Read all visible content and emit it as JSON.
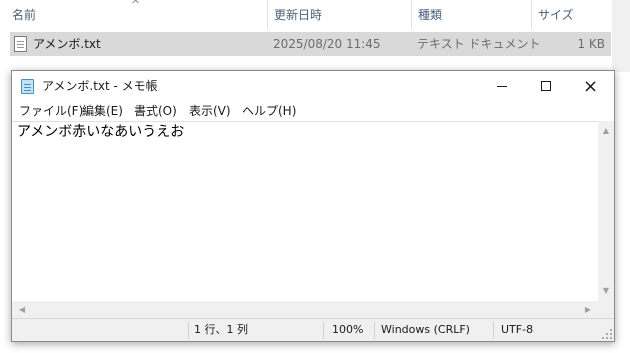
{
  "explorer": {
    "columns": {
      "name": "名前",
      "modified": "更新日時",
      "type": "種類",
      "size": "サイズ"
    },
    "sort_arrow": "^",
    "file": {
      "name": "アメンボ.txt",
      "modified": "2025/08/20 11:45",
      "type": "テキスト ドキュメント",
      "size": "1 KB",
      "icon": "text-file-icon"
    }
  },
  "notepad": {
    "title": "アメンボ.txt - メモ帳",
    "app_icon": "notepad-icon",
    "window_buttons": {
      "minimize": "minimize-icon",
      "maximize": "maximize-icon",
      "close": "×"
    },
    "menu": [
      "ファイル(F)",
      "編集(E)",
      "書式(O)",
      "表示(V)",
      "ヘルプ(H)"
    ],
    "content": "アメンボ赤いなあいうえお",
    "scroll": {
      "up": "▲",
      "down": "▼",
      "left": "◀",
      "right": "▶"
    },
    "status": {
      "position": "1 行、1 列",
      "zoom": "100%",
      "line_ending": "Windows (CRLF)",
      "encoding": "UTF-8"
    }
  }
}
